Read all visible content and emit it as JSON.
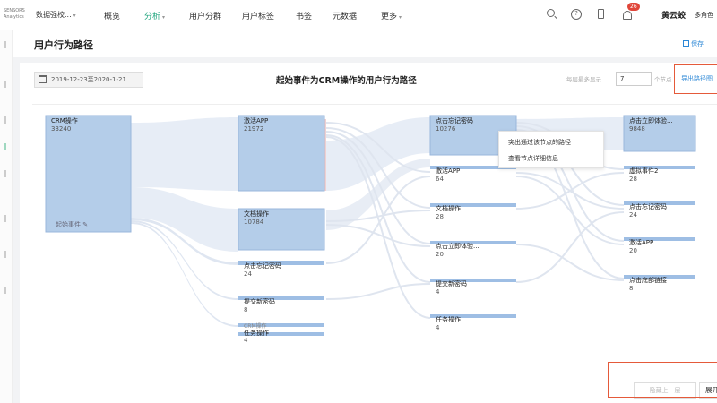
{
  "nav": {
    "logo_lines": [
      "SENSORS",
      "Analytics"
    ],
    "project": "数据强校...",
    "items": [
      {
        "label": "概览",
        "active": false,
        "caret": false
      },
      {
        "label": "分析",
        "active": true,
        "caret": true
      },
      {
        "label": "用户分群",
        "active": false,
        "caret": false
      },
      {
        "label": "用户标签",
        "active": false,
        "caret": false
      },
      {
        "label": "书签",
        "active": false,
        "caret": false
      },
      {
        "label": "元数据",
        "active": false,
        "caret": false
      },
      {
        "label": "更多",
        "active": false,
        "caret": true
      }
    ],
    "icons": [
      "search-icon",
      "help-icon",
      "phone-icon",
      "bell-icon"
    ],
    "badge": "26",
    "username": "黄云蛟",
    "role": "多角色"
  },
  "page": {
    "title": "用户行为路径",
    "save_label": "保存"
  },
  "toolbar": {
    "date_range": "2019-12-23至2020-1-21",
    "chart_title": "起始事件为CRM操作的用户行为路径",
    "per_layer_label": "每层最多显示",
    "per_layer_value": "7",
    "per_layer_unit": "个节点",
    "export_label": "导出路径图"
  },
  "columns": [
    {
      "nodes": [
        {
          "label": "CRM操作",
          "count": "33240",
          "start_tag": "起始事件"
        }
      ]
    },
    {
      "nodes": [
        {
          "label": "激活APP",
          "count": "21972"
        },
        {
          "label": "文档操作",
          "count": "10784"
        },
        {
          "label": "点击忘记密码",
          "count": "24"
        },
        {
          "label": "提交新密码",
          "count": "8"
        },
        {
          "label": "CRM操作",
          "count": ""
        },
        {
          "label": "任务操作",
          "count": "4"
        }
      ]
    },
    {
      "nodes": [
        {
          "label": "点击忘记密码",
          "count": "10276"
        },
        {
          "label": "激活APP",
          "count": "64"
        },
        {
          "label": "文档操作",
          "count": "28"
        },
        {
          "label": "点击立即体验...",
          "count": "20"
        },
        {
          "label": "提交新密码",
          "count": "4"
        },
        {
          "label": "任务操作",
          "count": "4"
        }
      ]
    },
    {
      "nodes": [
        {
          "label": "点击立即体验...",
          "count": "9848"
        },
        {
          "label": "虚拟事件2",
          "count": "28"
        },
        {
          "label": "点击忘记密码",
          "count": "24"
        },
        {
          "label": "激活APP",
          "count": "20"
        },
        {
          "label": "点击底部链接",
          "count": "8"
        }
      ]
    }
  ],
  "context_menu": {
    "items": [
      "突出通过该节点的路径",
      "查看节点详细信息"
    ]
  },
  "footer": {
    "hide_label": "隐藏上一层",
    "expand_label": "展开下一层"
  },
  "colors": {
    "node_fill": "#b4cde9",
    "flow": "#e4ebf5",
    "accent": "#1aa37a",
    "link": "#2b87d6",
    "highlight": "#e55a3a"
  }
}
